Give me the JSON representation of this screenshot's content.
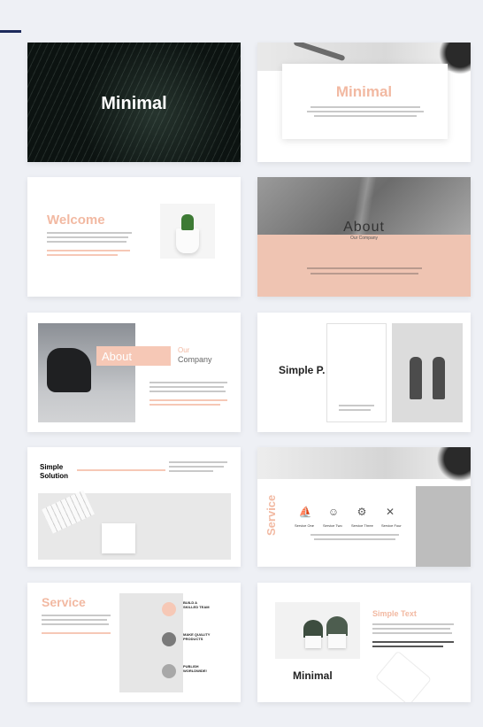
{
  "slides": [
    {
      "title": "Minimal"
    },
    {
      "title": "Minimal"
    },
    {
      "title": "Welcome"
    },
    {
      "title": "About",
      "subtitle": "Our Company"
    },
    {
      "title": "About",
      "title_our": "Our",
      "title_company": "Company"
    },
    {
      "title": "Simple P."
    },
    {
      "title_line1": "Simple",
      "title_line2": "Solution"
    },
    {
      "title": "Service",
      "services": [
        "Service One",
        "Service Two",
        "Service Three",
        "Service Four"
      ]
    },
    {
      "title": "Service",
      "items": [
        {
          "line1": "BUILD A",
          "line2": "SKILLED TEAM"
        },
        {
          "line1": "MAKE QUALITY",
          "line2": "PRODUCTS"
        },
        {
          "line1": "PUBLISH",
          "line2": "WORLDWIDE!"
        }
      ]
    },
    {
      "title": "Minimal",
      "subtitle": "Simple Text"
    }
  ],
  "colors": {
    "accent": "#f2b9a2",
    "navy": "#1d2a5c",
    "background": "#eef0f5"
  }
}
